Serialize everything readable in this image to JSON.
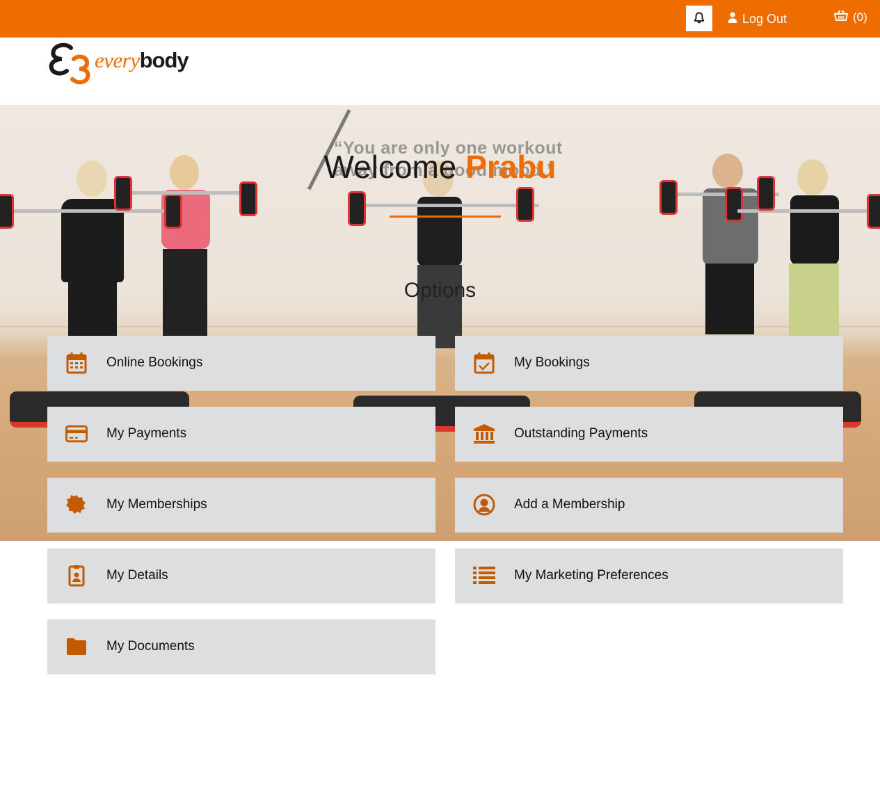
{
  "header": {
    "logout_label": "Log Out",
    "cart_count": "(0)",
    "accent_color": "#ef6c00"
  },
  "logo": {
    "every": "every",
    "body": "body"
  },
  "hero": {
    "quote": "“You are only one workout away from a good mood.”",
    "welcome_prefix": "Welcome",
    "user_name": "Prabu",
    "options_title": "Options"
  },
  "options": [
    {
      "label": "Online Bookings",
      "icon": "calendar-icon"
    },
    {
      "label": "My Bookings",
      "icon": "calendar-check-icon"
    },
    {
      "label": "My Payments",
      "icon": "credit-card-icon"
    },
    {
      "label": "Outstanding Payments",
      "icon": "bank-icon"
    },
    {
      "label": "My Memberships",
      "icon": "badge-icon"
    },
    {
      "label": "Add a Membership",
      "icon": "user-circle-icon"
    },
    {
      "label": "My Details",
      "icon": "id-badge-icon"
    },
    {
      "label": "My Marketing Preferences",
      "icon": "list-icon"
    },
    {
      "label": "My Documents",
      "icon": "folder-icon"
    }
  ],
  "icon_color": "#c25a00"
}
